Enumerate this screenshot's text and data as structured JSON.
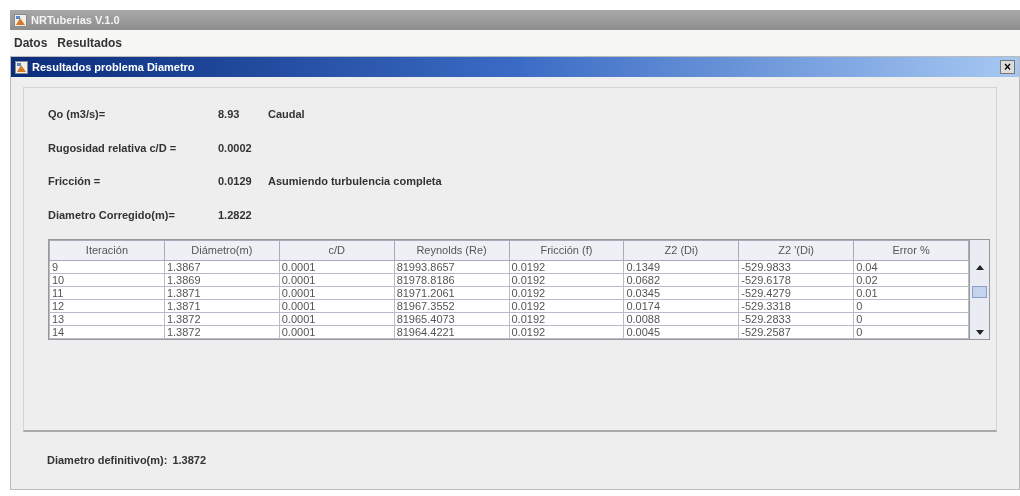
{
  "window": {
    "title": "NRTuberias V.1.0"
  },
  "menu": [
    "Datos",
    "Resultados"
  ],
  "frame": {
    "title": "Resultados problema Diametro",
    "close": "×"
  },
  "fields": [
    {
      "label": "Qo (m3/s)=",
      "value": "8.93",
      "note": "Caudal"
    },
    {
      "label": "Rugosidad relativa c/D =",
      "value": "0.0002"
    },
    {
      "label": "Fricción =",
      "value": "0.0129",
      "note": "Asumiendo turbulencia completa"
    },
    {
      "label": "Diametro Corregido(m)=",
      "value": "1.2822"
    }
  ],
  "table": {
    "columns": [
      "Iteración",
      "Diámetro(m)",
      "c/D",
      "Reynolds (Re)",
      "Fricción (f)",
      "Z2 (Di)",
      "Z2 '(Di)",
      "Error %"
    ],
    "rows": [
      [
        "9",
        "1.3867",
        "0.0001",
        "81993.8657",
        "0.0192",
        "0.1349",
        "-529.9833",
        "0.04"
      ],
      [
        "10",
        "1.3869",
        "0.0001",
        "81978.8186",
        "0.0192",
        "0.0682",
        "-529.6178",
        "0.02"
      ],
      [
        "11",
        "1.3871",
        "0.0001",
        "81971.2061",
        "0.0192",
        "0.0345",
        "-529.4279",
        "0.01"
      ],
      [
        "12",
        "1.3871",
        "0.0001",
        "81967.3552",
        "0.0192",
        "0.0174",
        "-529.3318",
        "0"
      ],
      [
        "13",
        "1.3872",
        "0.0001",
        "81965.4073",
        "0.0192",
        "0.0088",
        "-529.2833",
        "0"
      ],
      [
        "14",
        "1.3872",
        "0.0001",
        "81964.4221",
        "0.0192",
        "0.0045",
        "-529.2587",
        "0"
      ]
    ]
  },
  "result": {
    "label": "Diametro definitivo(m):",
    "value": "1.3872"
  }
}
